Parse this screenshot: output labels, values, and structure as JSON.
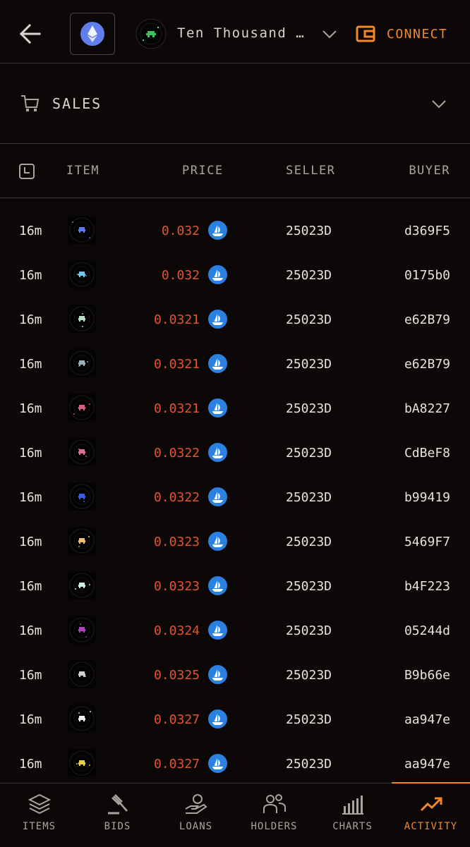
{
  "header": {
    "collection_name": "Ten Thousand …",
    "connect_label": "CONNECT",
    "back_icon": "arrow-left-icon",
    "chain_icon": "ethereum-icon",
    "wallet_icon": "wallet-icon"
  },
  "section": {
    "label": "SALES",
    "icon": "cart-icon"
  },
  "table": {
    "headers": {
      "time_icon": "clock-icon",
      "item": "ITEM",
      "price": "PRICE",
      "seller": "SELLER",
      "buyer": "BUYER"
    },
    "rows": [
      {
        "time": "16m",
        "price": "0.032",
        "seller": "25023D",
        "buyer": "d369F5",
        "thumb_color": "#5b7cf0"
      },
      {
        "time": "16m",
        "price": "0.032",
        "seller": "25023D",
        "buyer": "0175b0",
        "thumb_color": "#6cc6ee"
      },
      {
        "time": "16m",
        "price": "0.0321",
        "seller": "25023D",
        "buyer": "e62B79",
        "thumb_color": "#b8e0c8"
      },
      {
        "time": "16m",
        "price": "0.0321",
        "seller": "25023D",
        "buyer": "e62B79",
        "thumb_color": "#9ab0b8"
      },
      {
        "time": "16m",
        "price": "0.0321",
        "seller": "25023D",
        "buyer": "bA8227",
        "thumb_color": "#e05a8c"
      },
      {
        "time": "16m",
        "price": "0.0322",
        "seller": "25023D",
        "buyer": "CdBeF8",
        "thumb_color": "#e06a9a"
      },
      {
        "time": "16m",
        "price": "0.0322",
        "seller": "25023D",
        "buyer": "b99419",
        "thumb_color": "#3a5ee0"
      },
      {
        "time": "16m",
        "price": "0.0323",
        "seller": "25023D",
        "buyer": "5469F7",
        "thumb_color": "#f0c070"
      },
      {
        "time": "16m",
        "price": "0.0323",
        "seller": "25023D",
        "buyer": "b4F223",
        "thumb_color": "#c8f0e8"
      },
      {
        "time": "16m",
        "price": "0.0324",
        "seller": "25023D",
        "buyer": "05244d",
        "thumb_color": "#b040c0"
      },
      {
        "time": "16m",
        "price": "0.0325",
        "seller": "25023D",
        "buyer": "B9b66e",
        "thumb_color": "#d0d0d0"
      },
      {
        "time": "16m",
        "price": "0.0327",
        "seller": "25023D",
        "buyer": "aa947e",
        "thumb_color": "#f0f0f0"
      },
      {
        "time": "16m",
        "price": "0.0327",
        "seller": "25023D",
        "buyer": "aa947e",
        "thumb_color": "#e8d040"
      }
    ],
    "marketplace_icon": "opensea-icon"
  },
  "bottom_nav": [
    {
      "label": "ITEMS",
      "icon": "layers-icon",
      "active": false
    },
    {
      "label": "BIDS",
      "icon": "gavel-icon",
      "active": false
    },
    {
      "label": "LOANS",
      "icon": "loan-hand-icon",
      "active": false
    },
    {
      "label": "HOLDERS",
      "icon": "users-icon",
      "active": false
    },
    {
      "label": "CHARTS",
      "icon": "bar-chart-icon",
      "active": false
    },
    {
      "label": "ACTIVITY",
      "icon": "trend-up-icon",
      "active": true
    }
  ],
  "colors": {
    "accent": "#f1892a",
    "price": "#e2542c",
    "background": "#0c0807",
    "opensea": "#2b81e1"
  }
}
